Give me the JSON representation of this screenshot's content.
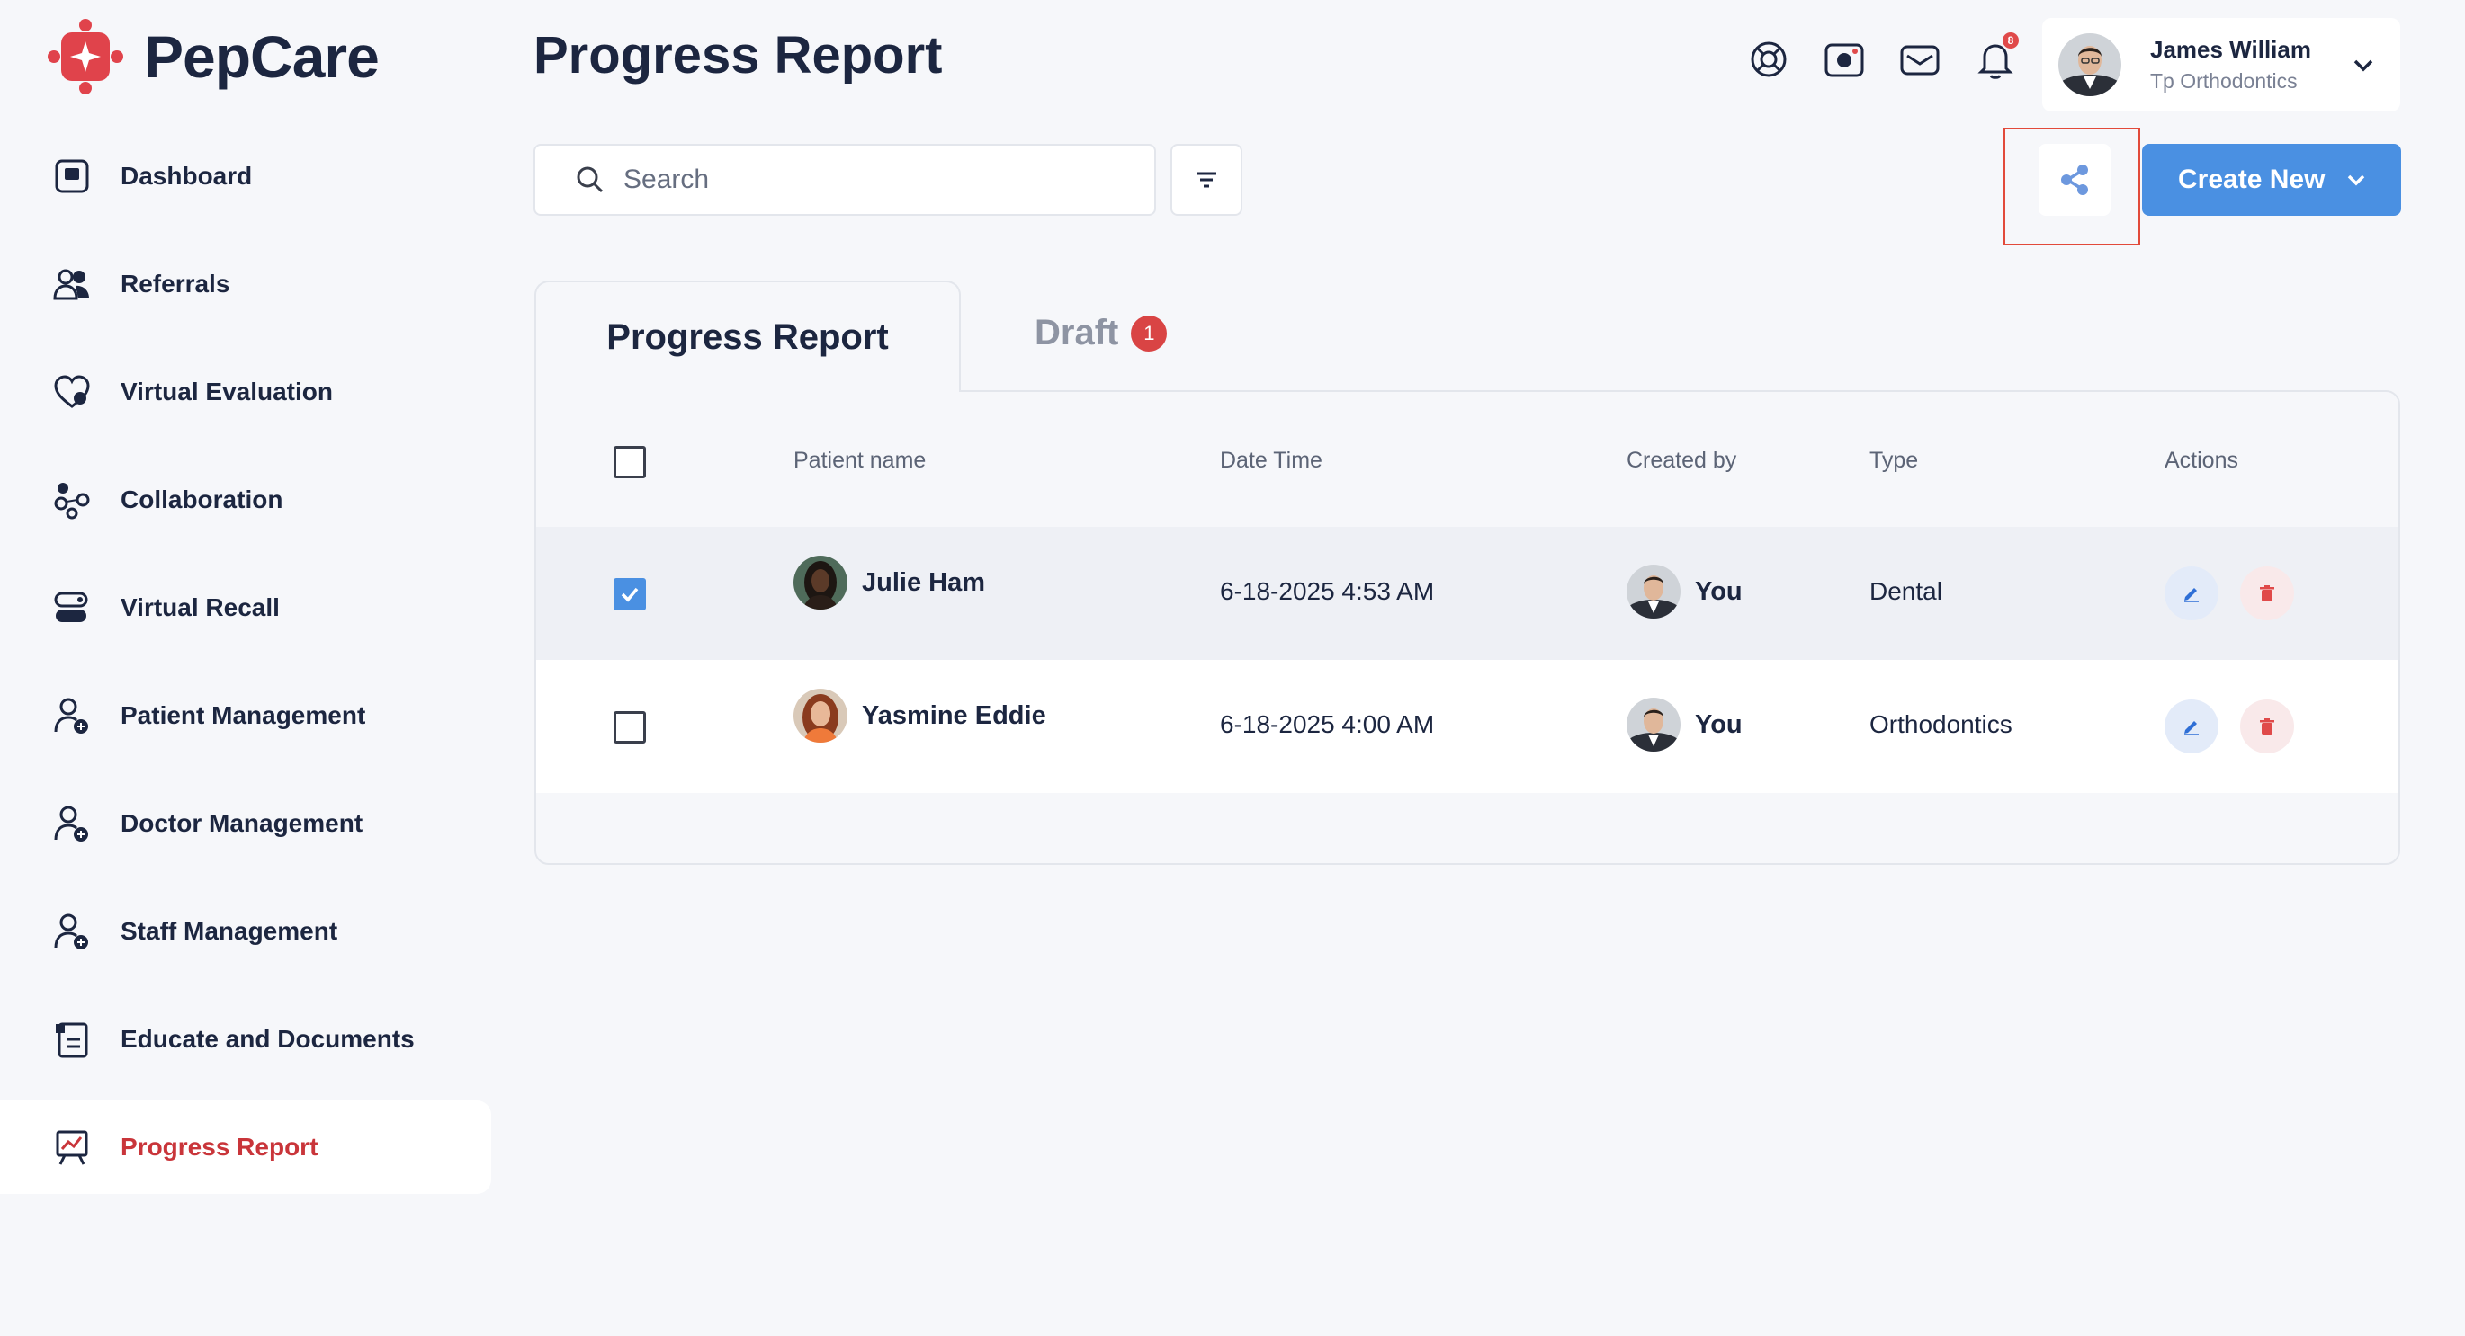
{
  "app": {
    "name": "PepCare",
    "colors": {
      "brand_red": "#e0434b",
      "accent_blue": "#4a90e2",
      "navy": "#1c2640"
    }
  },
  "sidebar": {
    "items": [
      {
        "label": "Dashboard",
        "icon": "dashboard-icon",
        "active": false
      },
      {
        "label": "Referrals",
        "icon": "users-icon",
        "active": false
      },
      {
        "label": "Virtual Evaluation",
        "icon": "heart-pulse-icon",
        "active": false
      },
      {
        "label": "Collaboration",
        "icon": "network-icon",
        "active": false
      },
      {
        "label": "Virtual Recall",
        "icon": "recall-icon",
        "active": false
      },
      {
        "label": "Patient Management",
        "icon": "user-manage-icon",
        "active": false
      },
      {
        "label": "Doctor Management",
        "icon": "user-add-icon",
        "active": false
      },
      {
        "label": "Staff Management",
        "icon": "user-add-icon",
        "active": false
      },
      {
        "label": "Educate and Documents",
        "icon": "document-icon",
        "active": false
      },
      {
        "label": "Progress Report",
        "icon": "chart-board-icon",
        "active": true
      }
    ]
  },
  "header": {
    "title": "Progress Report",
    "icons": [
      "support-icon",
      "camera-icon",
      "mail-icon",
      "bell-icon"
    ],
    "notification_count": "8",
    "user": {
      "name": "James William",
      "org": "Tp Orthodontics"
    }
  },
  "toolbar": {
    "search_placeholder": "Search",
    "create_label": "Create New"
  },
  "tabs": {
    "active": "Progress Report",
    "draft": "Draft",
    "draft_count": "1"
  },
  "table": {
    "columns": [
      "Patient name",
      "Date Time",
      "Created by",
      "Type",
      "Actions"
    ],
    "rows": [
      {
        "patient": "Julie Ham",
        "datetime": "6-18-2025 4:53 AM",
        "created_by": "You",
        "type": "Dental",
        "checked": true
      },
      {
        "patient": "Yasmine Eddie",
        "datetime": "6-18-2025 4:00 AM",
        "created_by": "You",
        "type": "Orthodontics",
        "checked": false
      }
    ]
  }
}
